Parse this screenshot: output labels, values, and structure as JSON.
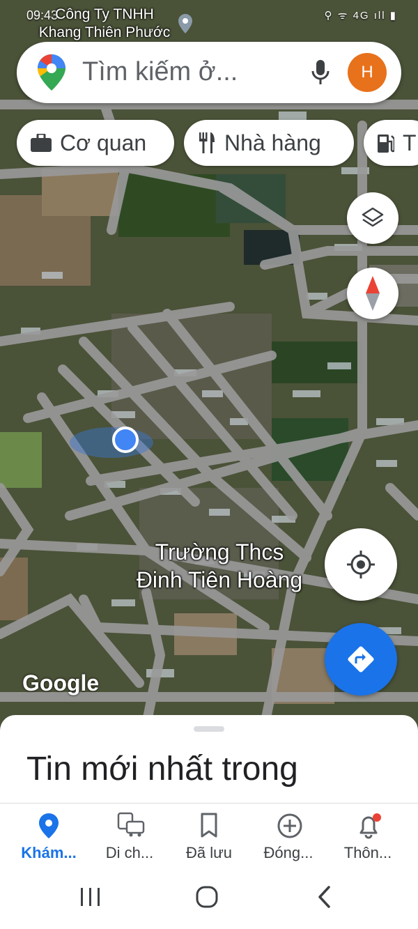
{
  "status_bar": {
    "time": "09:43",
    "icons": "⚲ ᯤ 4G ıll ▮"
  },
  "map": {
    "top_place": "Công Ty TNHH\nKhang Thiên Phước",
    "school_label": "Trường Thcs\nĐinh Tiên Hoàng",
    "watermark": "Google",
    "colors": {
      "road": "#9a9a9a",
      "field": "#6b6048",
      "vegetation": "#2f4a23",
      "accent": "#1a73e8"
    }
  },
  "search": {
    "placeholder": "Tìm kiếm ở...",
    "avatar_letter": "H"
  },
  "chips": [
    {
      "icon": "briefcase-icon",
      "label": "Cơ quan"
    },
    {
      "icon": "restaurant-icon",
      "label": "Nhà hàng"
    },
    {
      "icon": "gas-station-icon",
      "label": "T"
    }
  ],
  "sheet": {
    "title": "Tin mới nhất trong"
  },
  "bottom_nav": [
    {
      "icon": "explore-pin-icon",
      "label": "Khám...",
      "active": true
    },
    {
      "icon": "commute-icon",
      "label": "Di ch...",
      "active": false
    },
    {
      "icon": "bookmark-icon",
      "label": "Đã lưu",
      "active": false
    },
    {
      "icon": "add-circle-icon",
      "label": "Đóng...",
      "active": false
    },
    {
      "icon": "notification-bell-icon",
      "label": "Thôn...",
      "active": false
    }
  ]
}
